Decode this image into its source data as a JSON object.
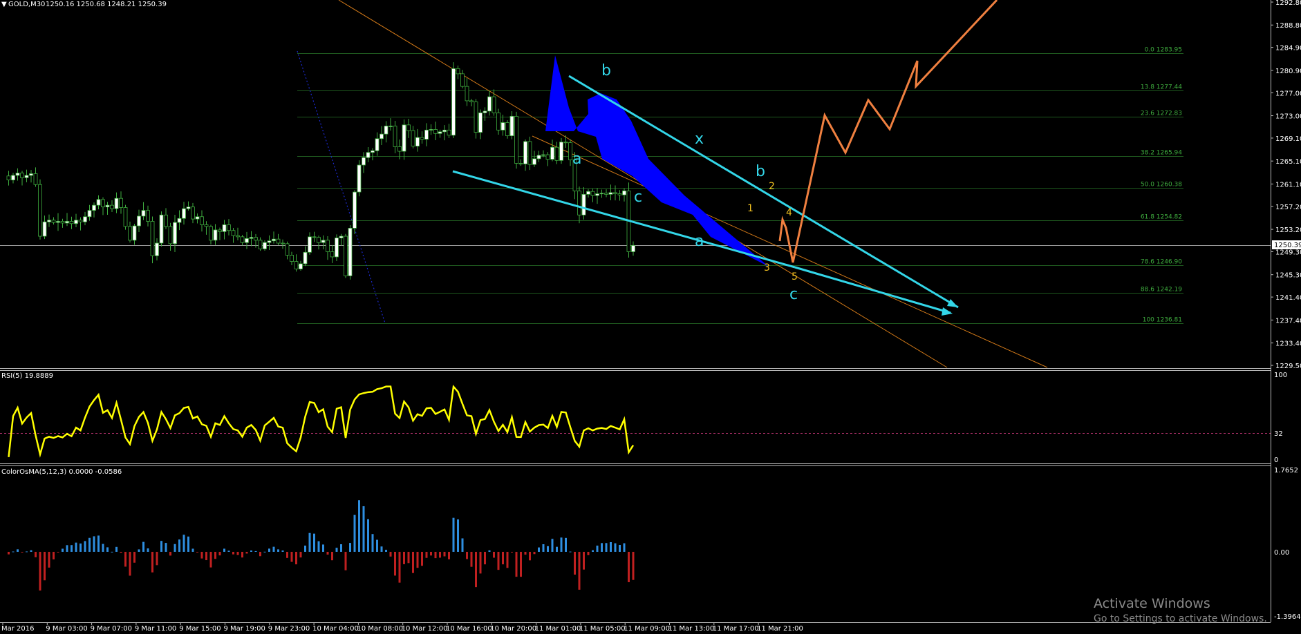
{
  "header": {
    "symbol_label": "GOLD,M30",
    "ohlc": "1250.16 1250.68 1248.21 1250.39",
    "menu_glyph": "▼"
  },
  "price_axis": {
    "labels": [
      "1292.80",
      "1288.80",
      "1284.90",
      "1280.90",
      "1277.00",
      "1273.00",
      "1269.10",
      "1265.10",
      "1261.10",
      "1257.20",
      "1253.20",
      "1249.30",
      "1245.30",
      "1241.40",
      "1237.40",
      "1233.40",
      "1229.50"
    ],
    "current_price": "1250.39"
  },
  "fib_levels": [
    {
      "label": "0.0 1283.95",
      "price": 1283.95
    },
    {
      "label": "13.8 1277.44",
      "price": 1277.44
    },
    {
      "label": "23.6 1272.83",
      "price": 1272.83
    },
    {
      "label": "38.2 1265.94",
      "price": 1265.94
    },
    {
      "label": "50.0 1260.38",
      "price": 1260.38
    },
    {
      "label": "61.8 1254.82",
      "price": 1254.82
    },
    {
      "label": "78.6 1246.90",
      "price": 1246.9
    },
    {
      "label": "88.6 1242.19",
      "price": 1242.19
    },
    {
      "label": "100 1236.81",
      "price": 1236.81
    }
  ],
  "wave_labels": {
    "cyan": [
      "b",
      "a",
      "c",
      "x",
      "b",
      "a",
      "c"
    ],
    "yellow": [
      "2",
      "1",
      "4",
      "3",
      "5"
    ]
  },
  "rsi": {
    "title": "RSI(5) 19.8889",
    "axis_labels": [
      "100",
      "32",
      "0"
    ],
    "level": 32
  },
  "osma": {
    "title": "ColorOsMA(5,12,3) 0.0000 -0.0586",
    "axis_labels": [
      "1.7652",
      "0.00",
      "-1.3964"
    ]
  },
  "time_axis": {
    "labels": [
      "Mar 2016",
      "9 Mar 03:00",
      "9 Mar 07:00",
      "9 Mar 11:00",
      "9 Mar 15:00",
      "9 Mar 19:00",
      "9 Mar 23:00",
      "10 Mar 04:00",
      "10 Mar 08:00",
      "10 Mar 12:00",
      "10 Mar 16:00",
      "10 Mar 20:00",
      "11 Mar 01:00",
      "11 Mar 05:00",
      "11 Mar 09:00",
      "11 Mar 13:00",
      "11 Mar 17:00",
      "11 Mar 21:00"
    ]
  },
  "watermark": {
    "line1": "Activate Windows",
    "line2": "Go to Settings to activate Windows."
  },
  "colors": {
    "background": "#000000",
    "bull_candle": "#ffffff",
    "bear_candle": "#000000",
    "candle_wick": "#3fae3f",
    "fib_line": "#1f5a1f",
    "channel": "#33d6e8",
    "projection": "#f08040",
    "trend_orange": "#d07818",
    "rsi_line": "#ffff00",
    "osma_up": "#2e8ee0",
    "osma_down": "#c02020",
    "pattern_fill": "#0000ff"
  },
  "chart_data": {
    "type": "candlestick",
    "symbol": "GOLD",
    "timeframe": "M30",
    "x_range": [
      "8 Mar 2016",
      "11 Mar 2016 22:00"
    ],
    "y_range": [
      1229.5,
      1294.0
    ],
    "close_path": [
      1262.5,
      1261.8,
      1262.6,
      1263.0,
      1262.2,
      1262.6,
      1262.9,
      1261.0,
      1252.0,
      1254.5,
      1254.8,
      1254.4,
      1254.6,
      1254.3,
      1254.6,
      1254.2,
      1254.8,
      1254.5,
      1255.4,
      1256.5,
      1257.4,
      1258.4,
      1257.1,
      1257.4,
      1256.8,
      1258.6,
      1257.0,
      1253.7,
      1251.3,
      1253.8,
      1255.5,
      1256.5,
      1254.6,
      1248.6,
      1250.8,
      1255.7,
      1253.7,
      1250.7,
      1254.4,
      1255.1,
      1256.8,
      1257.1,
      1255.0,
      1255.4,
      1254.0,
      1253.7,
      1251.3,
      1253.1,
      1252.8,
      1254.0,
      1253.0,
      1252.1,
      1251.9,
      1250.9,
      1251.6,
      1251.8,
      1251.3,
      1249.8,
      1250.9,
      1251.2,
      1251.5,
      1250.8,
      1250.7,
      1248.7,
      1247.6,
      1246.3,
      1247.2,
      1249.2,
      1251.9,
      1251.8,
      1250.9,
      1251.3,
      1249.3,
      1248.4,
      1251.7,
      1252.0,
      1245.1,
      1253.4,
      1259.7,
      1264.4,
      1265.7,
      1266.6,
      1266.9,
      1269.0,
      1269.8,
      1271.2,
      1271.2,
      1267.6,
      1266.8,
      1271.4,
      1270.4,
      1267.7,
      1269.2,
      1268.9,
      1270.5,
      1270.6,
      1269.9,
      1270.2,
      1270.5,
      1269.6,
      1281.2,
      1280.3,
      1278.1,
      1275.6,
      1275.4,
      1270.1,
      1273.5,
      1273.8,
      1276.3,
      1273.5,
      1270.5,
      1271.8,
      1269.5,
      1272.9,
      1264.7,
      1264.6,
      1268.5,
      1264.5,
      1265.5,
      1266.1,
      1266.2,
      1265.4,
      1267.5,
      1265.2,
      1268.4,
      1268.3,
      1265.3,
      1259.9,
      1255.7,
      1259.3,
      1259.8,
      1259.1,
      1259.4,
      1259.5,
      1259.3,
      1259.6,
      1259.4,
      1259.2,
      1259.9,
      1249.3,
      1250.4
    ],
    "fib_retracement_levels": [
      {
        "pct": 0.0,
        "price": 1283.95
      },
      {
        "pct": 13.8,
        "price": 1277.44
      },
      {
        "pct": 23.6,
        "price": 1272.83
      },
      {
        "pct": 38.2,
        "price": 1265.94
      },
      {
        "pct": 50.0,
        "price": 1260.38
      },
      {
        "pct": 61.8,
        "price": 1254.82
      },
      {
        "pct": 78.6,
        "price": 1246.9
      },
      {
        "pct": 88.6,
        "price": 1242.19
      },
      {
        "pct": 100,
        "price": 1236.81
      }
    ],
    "indicators": [
      {
        "name": "RSI(5)",
        "last_value": 19.8889,
        "range": [
          0,
          100
        ],
        "level": 32
      },
      {
        "name": "ColorOsMA(5,12,3)",
        "last_value": -0.0586,
        "range": [
          -1.3964,
          1.7652
        ]
      }
    ]
  }
}
